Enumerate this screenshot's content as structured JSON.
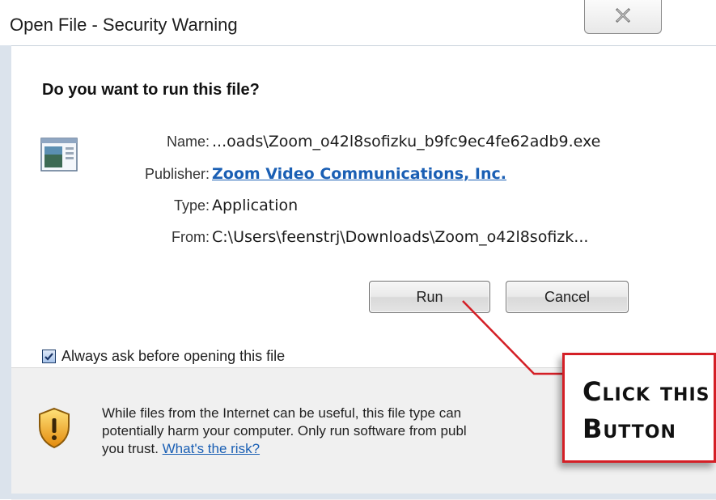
{
  "window": {
    "title": "Open File - Security Warning"
  },
  "dialog": {
    "heading": "Do you want to run this file?",
    "fields": {
      "name_label": "Name:",
      "name_value": "...oads\\Zoom_o42l8sofizku_b9fc9ec4fe62adb9.exe",
      "publisher_label": "Publisher:",
      "publisher_value": "Zoom Video Communications, Inc.",
      "type_label": "Type:",
      "type_value": "Application",
      "from_label": "From:",
      "from_value": "C:\\Users\\feenstrj\\Downloads\\Zoom_o42l8sofizk..."
    },
    "buttons": {
      "run": "Run",
      "cancel": "Cancel"
    },
    "checkbox": {
      "label": "Always ask before opening this file",
      "checked": true
    }
  },
  "warning": {
    "line1": "While files from the Internet can be useful, this file type can",
    "line2": "potentially harm your computer. Only run software from publ",
    "line3_prefix": "you trust. ",
    "risk_link": "What's the risk?"
  },
  "callout": {
    "line1": "Click this",
    "line2": "Button"
  },
  "colors": {
    "link": "#1a5fb4",
    "callout_border": "#d41f26"
  },
  "icons": {
    "file": "application-file-icon",
    "shield": "security-shield-icon",
    "close": "close-x-icon"
  }
}
